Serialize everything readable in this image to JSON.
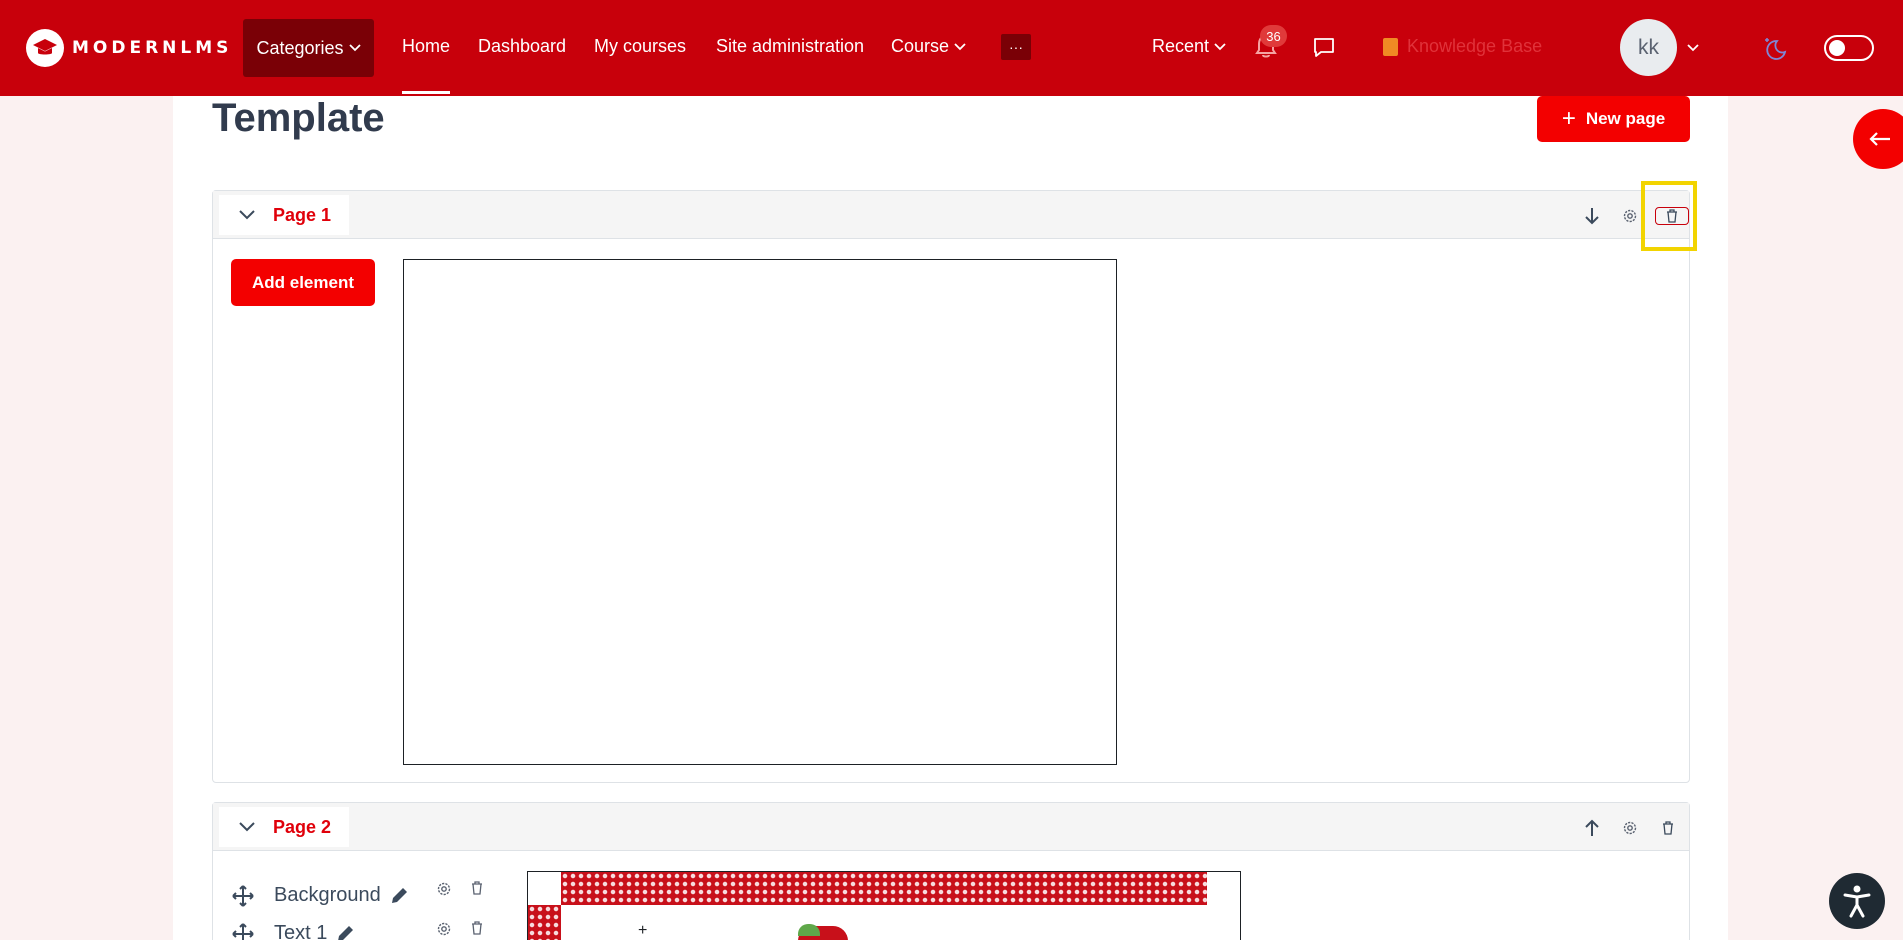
{
  "navbar": {
    "logo_text": "MODERNLMS",
    "categories_label": "Categories",
    "links": {
      "home": "Home",
      "dashboard": "Dashboard",
      "my_courses": "My courses",
      "site_administration": "Site administration",
      "course": "Course"
    },
    "more_label": "···",
    "recent_label": "Recent",
    "notification_count": "36",
    "knowledge_base_label": "Knowledge Base",
    "user_initials": "kk"
  },
  "main": {
    "title": "Template",
    "new_page_label": "New page",
    "add_element_label": "Add element",
    "pages": [
      {
        "label": "Page 1"
      },
      {
        "label": "Page 2",
        "elements": [
          {
            "label": "Background"
          },
          {
            "label": "Text 1"
          }
        ]
      }
    ]
  },
  "colors": {
    "brand": "#c8000b",
    "accent": "#f30000",
    "highlight": "#f2d400"
  }
}
